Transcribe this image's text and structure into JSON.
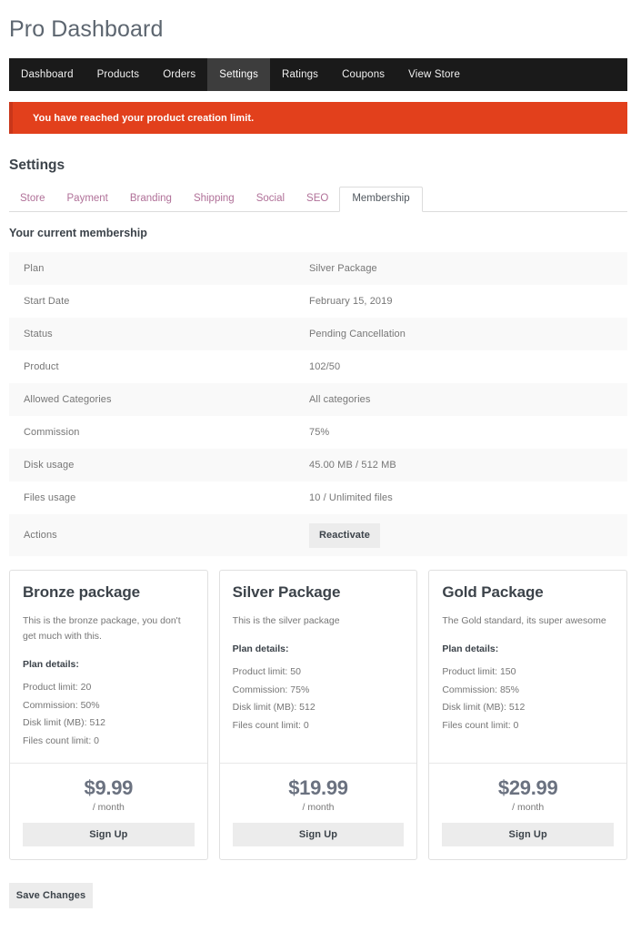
{
  "header": {
    "title": "Pro Dashboard"
  },
  "topnav": {
    "items": [
      {
        "label": "Dashboard",
        "active": false
      },
      {
        "label": "Products",
        "active": false
      },
      {
        "label": "Orders",
        "active": false
      },
      {
        "label": "Settings",
        "active": true
      },
      {
        "label": "Ratings",
        "active": false
      },
      {
        "label": "Coupons",
        "active": false
      },
      {
        "label": "View Store",
        "active": false
      }
    ]
  },
  "alert": {
    "message": "You have reached your product creation limit.",
    "background_color": "#e2401c",
    "border_color": "#c9361a",
    "text_color": "#ffffff"
  },
  "settings": {
    "heading": "Settings",
    "tabs": [
      {
        "label": "Store",
        "active": false
      },
      {
        "label": "Payment",
        "active": false
      },
      {
        "label": "Branding",
        "active": false
      },
      {
        "label": "Shipping",
        "active": false
      },
      {
        "label": "Social",
        "active": false
      },
      {
        "label": "SEO",
        "active": false
      },
      {
        "label": "Membership",
        "active": true
      }
    ],
    "tab_link_color": "#b07098"
  },
  "membership": {
    "section_title": "Your current membership",
    "rows": [
      {
        "label": "Plan",
        "value": "Silver Package"
      },
      {
        "label": "Start Date",
        "value": "February 15, 2019"
      },
      {
        "label": "Status",
        "value": "Pending Cancellation"
      },
      {
        "label": "Product",
        "value": "102/50"
      },
      {
        "label": "Allowed Categories",
        "value": "All categories"
      },
      {
        "label": "Commission",
        "value": "75%"
      },
      {
        "label": "Disk usage",
        "value": "45.00 MB / 512 MB"
      },
      {
        "label": "Files usage",
        "value": "10 / Unlimited files"
      }
    ],
    "actions_label": "Actions",
    "reactivate_label": "Reactivate"
  },
  "packages": [
    {
      "title": "Bronze package",
      "description": "This is the bronze package, you don't get much with this.",
      "details_title": "Plan details:",
      "features": [
        "Product limit: 20",
        "Commission: 50%",
        "Disk limit (MB): 512",
        "Files count limit: 0"
      ],
      "price": "$9.99",
      "period": "/ month",
      "signup_label": "Sign Up"
    },
    {
      "title": "Silver Package",
      "description": "This is the silver package",
      "details_title": "Plan details:",
      "features": [
        "Product limit: 50",
        "Commission: 75%",
        "Disk limit (MB): 512",
        "Files count limit: 0"
      ],
      "price": "$19.99",
      "period": "/ month",
      "signup_label": "Sign Up"
    },
    {
      "title": "Gold Package",
      "description": "The Gold standard, its super awesome",
      "details_title": "Plan details:",
      "features": [
        "Product limit: 150",
        "Commission: 85%",
        "Disk limit (MB): 512",
        "Files count limit: 0"
      ],
      "price": "$29.99",
      "period": "/ month",
      "signup_label": "Sign Up"
    }
  ],
  "footer": {
    "save_label": "Save Changes"
  }
}
